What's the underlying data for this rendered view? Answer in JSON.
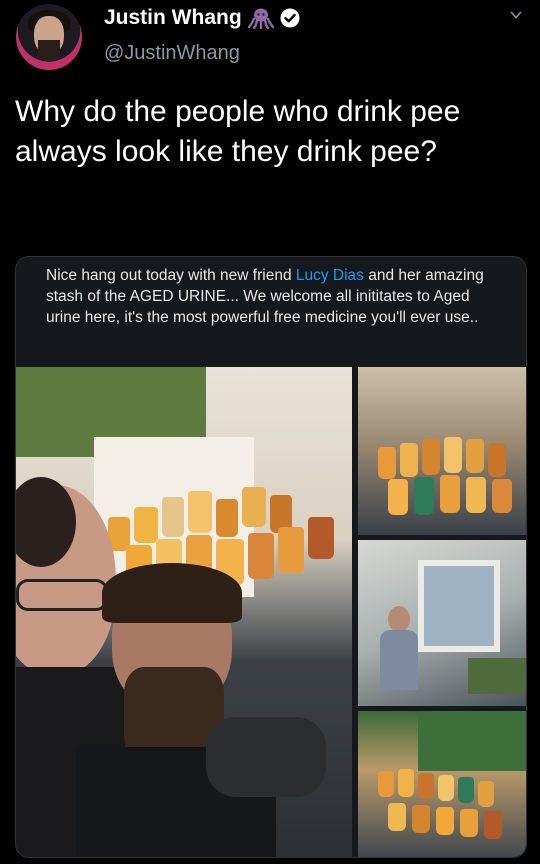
{
  "author": {
    "display_name": "Justin Whang",
    "handle": "@JustinWhang",
    "name_emoji_icon": "octopus-icon",
    "verified_icon": "verified-badge-icon"
  },
  "tweet": {
    "text": "Why do the people who drink pee always look like they drink pee?"
  },
  "embedded_post": {
    "text_before_mention": "Nice hang out today with new friend ",
    "mention": "Lucy Dias",
    "text_after_mention": " and her amazing stash of the AGED URINE... We welcome all inititates to Aged urine here, it's the most powerful free medicine you'll ever use..",
    "photos": [
      "selfie-with-jars-photo",
      "jars-on-floor-photo",
      "woman-by-window-photo",
      "jars-overview-photo"
    ]
  },
  "colors": {
    "background": "#000000",
    "handle_gray": "#8b98a5",
    "mention_blue": "#1d9bf0",
    "verified_bg": "#ffffff"
  }
}
